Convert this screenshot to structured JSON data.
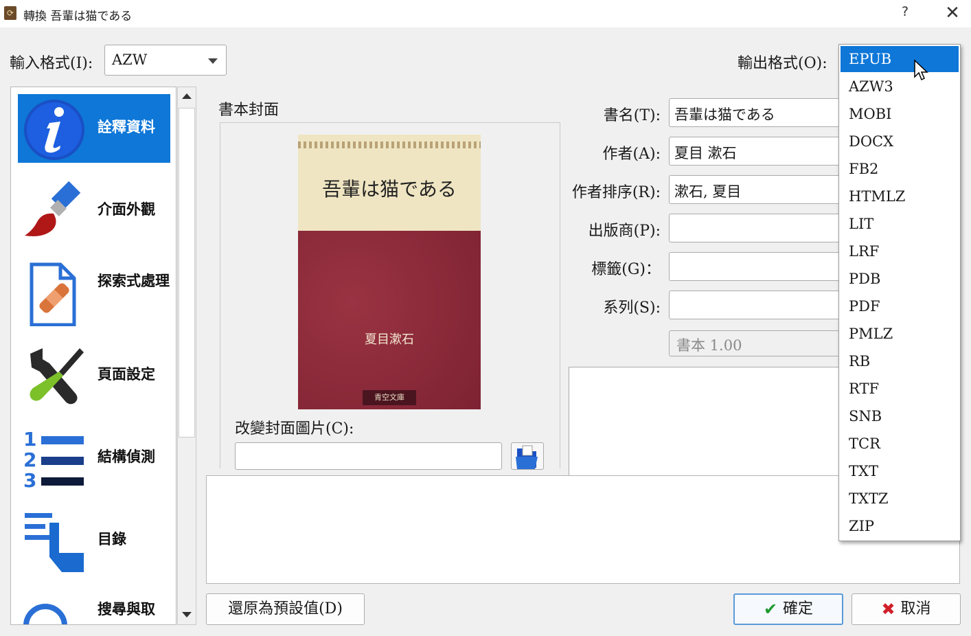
{
  "window": {
    "title": "轉換 吾輩は猫である",
    "help": "?",
    "close": "✕",
    "app_icon": "calibre-icon"
  },
  "formats": {
    "input_label": "輸入格式(I):",
    "input_value": "AZW",
    "output_label": "輸出格式(O):",
    "output_options": [
      "EPUB",
      "AZW3",
      "MOBI",
      "DOCX",
      "FB2",
      "HTMLZ",
      "LIT",
      "LRF",
      "PDB",
      "PDF",
      "PMLZ",
      "RB",
      "RTF",
      "SNB",
      "TCR",
      "TXT",
      "TXTZ",
      "ZIP"
    ],
    "output_selected": "EPUB"
  },
  "sidebar": {
    "items": [
      {
        "label": "詮釋資料",
        "icon": "info-icon",
        "selected": true
      },
      {
        "label": "介面外觀",
        "icon": "paintbrush-icon"
      },
      {
        "label": "探索式處理",
        "icon": "document-bandage-icon"
      },
      {
        "label": "頁面設定",
        "icon": "wrench-screwdriver-icon"
      },
      {
        "label": "結構偵測",
        "icon": "numbered-list-icon"
      },
      {
        "label": "目錄",
        "icon": "toc-hand-icon"
      },
      {
        "label": "搜尋與取",
        "icon": "magnifier-icon"
      }
    ]
  },
  "cover": {
    "group_title": "書本封面",
    "book_title": "吾輩は猫である",
    "book_author": "夏目漱石",
    "book_publisher": "青空文庫",
    "change_label": "改變封面圖片(C):",
    "path_value": ""
  },
  "metadata": {
    "title_label": "書名(T):",
    "title_value": "吾輩は猫である",
    "author_label": "作者(A):",
    "author_value": "夏目 漱石",
    "author_sort_label": "作者排序(R):",
    "author_sort_value": "漱石, 夏目",
    "publisher_label": "出版商(P):",
    "publisher_value": "",
    "tags_label": "標籤(G)：",
    "tags_value": "",
    "series_label": "系列(S):",
    "series_value": "",
    "series_index": "書本 1.00"
  },
  "buttons": {
    "restore": "還原為預設值(D)",
    "ok": "確定",
    "cancel": "取消"
  },
  "colors": {
    "accent": "#0e77d8",
    "ok_check": "#1f9a2f",
    "cancel_x": "#d0202a"
  }
}
